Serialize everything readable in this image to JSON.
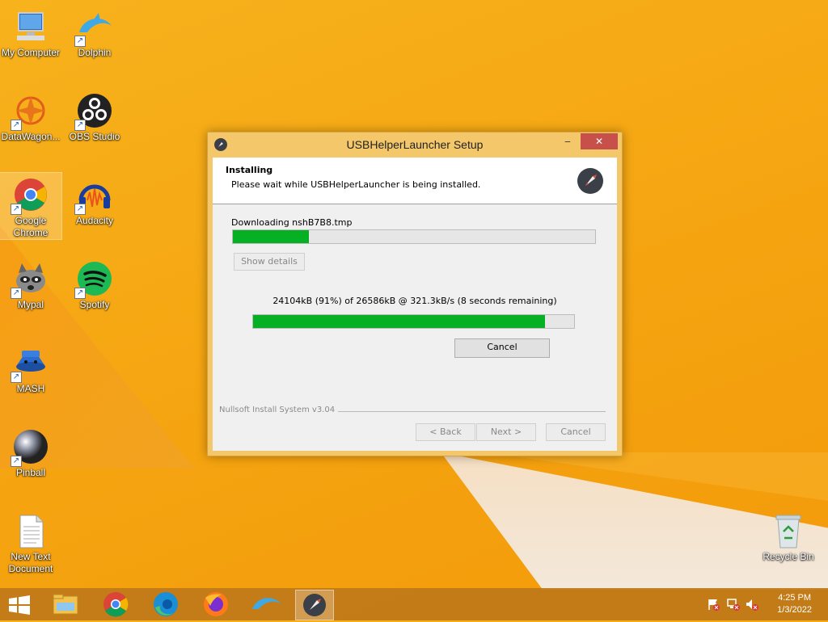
{
  "desktop": {
    "icons": [
      {
        "label": "My Computer"
      },
      {
        "label": "Dolphin"
      },
      {
        "label": "DataWagon..."
      },
      {
        "label": "OBS Studio"
      },
      {
        "label": "Google Chrome"
      },
      {
        "label": "Audacity"
      },
      {
        "label": "Mypal"
      },
      {
        "label": "Spotify"
      },
      {
        "label": "MASH"
      },
      {
        "label": "Pinball"
      },
      {
        "label": "New Text Document"
      },
      {
        "label": "Recycle Bin"
      }
    ]
  },
  "dialog": {
    "title": "USBHelperLauncher Setup",
    "controls": {
      "minimize": "‒",
      "maximize": "☐",
      "close": "✕"
    },
    "header_title": "Installing",
    "header_subtitle": "Please wait while USBHelperLauncher is being installed.",
    "status_text": "Downloading nshB7B8.tmp",
    "overall_progress": 0.21,
    "show_details_label": "Show details",
    "download_text": "24104kB (91%) of 26586kB @ 321.3kB/s (8 seconds remaining)",
    "download_progress": 0.91,
    "cancel_label": "Cancel",
    "branding": "Nullsoft Install System v3.04",
    "back_label": "< Back",
    "next_label": "Next >",
    "footer_cancel_label": "Cancel"
  },
  "taskbar": {
    "apps": [
      "file-explorer",
      "google-chrome",
      "microsoft-edge",
      "firefox",
      "dolphin",
      "usbhelperlauncher-setup"
    ],
    "time": "4:25 PM",
    "date": "1/3/2022"
  },
  "colors": {
    "progress_fill": "#06b025",
    "wallpaper": "#f6a712",
    "close_button": "#c7504a"
  }
}
